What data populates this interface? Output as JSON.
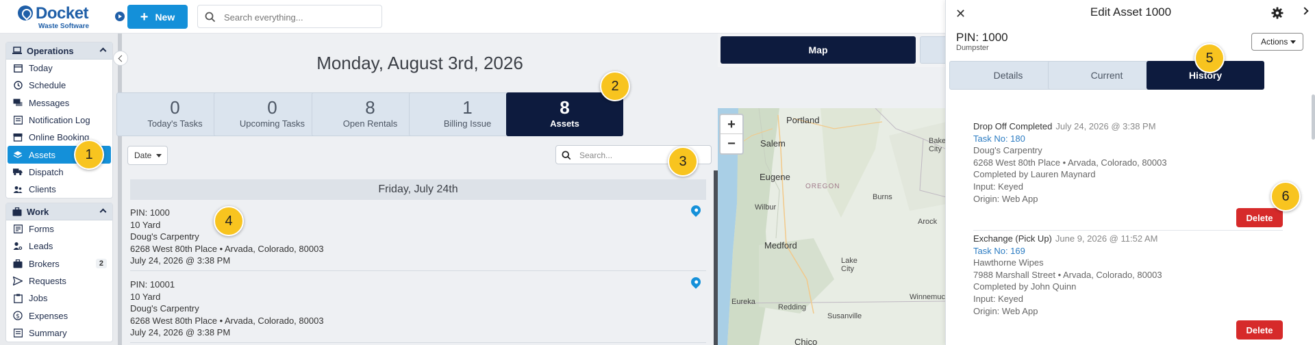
{
  "header": {
    "logo_name": "Docket",
    "logo_sub": "Waste Software",
    "new_label": "New",
    "search_placeholder": "Search everything..."
  },
  "sidebar": {
    "operations": {
      "title": "Operations",
      "items": [
        {
          "label": "Today",
          "icon": "calendar-icon"
        },
        {
          "label": "Schedule",
          "icon": "clock-icon"
        },
        {
          "label": "Messages",
          "icon": "chat-icon"
        },
        {
          "label": "Notification Log",
          "icon": "list-icon"
        },
        {
          "label": "Online Booking",
          "icon": "storefront-icon"
        },
        {
          "label": "Assets",
          "icon": "layers-icon",
          "active": true
        },
        {
          "label": "Dispatch",
          "icon": "truck-icon"
        },
        {
          "label": "Clients",
          "icon": "users-icon"
        }
      ]
    },
    "work": {
      "title": "Work",
      "items": [
        {
          "label": "Forms",
          "icon": "form-icon"
        },
        {
          "label": "Leads",
          "icon": "user-search-icon"
        },
        {
          "label": "Brokers",
          "icon": "briefcase-icon",
          "badge": "2"
        },
        {
          "label": "Requests",
          "icon": "send-icon"
        },
        {
          "label": "Jobs",
          "icon": "clipboard-icon"
        },
        {
          "label": "Expenses",
          "icon": "dollar-icon"
        },
        {
          "label": "Summary",
          "icon": "list-icon"
        }
      ]
    }
  },
  "main": {
    "date_title": "Monday, August 3rd, 2026",
    "stats": [
      {
        "num": "0",
        "label": "Today's Tasks"
      },
      {
        "num": "0",
        "label": "Upcoming Tasks"
      },
      {
        "num": "8",
        "label": "Open Rentals"
      },
      {
        "num": "1",
        "label": "Billing Issue"
      },
      {
        "num": "8",
        "label": "Assets",
        "active": true
      }
    ],
    "date_filter": "Date",
    "search_placeholder": "Search...",
    "day_header": "Friday, July 24th",
    "items": [
      {
        "pin": "PIN: 1000",
        "size": "10 Yard",
        "client": "Doug's Carpentry",
        "address": "6268 West 80th Place • Arvada, Colorado, 80003",
        "datetime": "July 24, 2026 @ 3:38 PM"
      },
      {
        "pin": "PIN: 10001",
        "size": "10 Yard",
        "client": "Doug's Carpentry",
        "address": "6268 West 80th Place • Arvada, Colorado, 80003",
        "datetime": "July 24, 2026 @ 3:38 PM"
      }
    ]
  },
  "map": {
    "tab_label": "Map",
    "zoom_in": "+",
    "zoom_out": "−",
    "labels": {
      "portland": "Portland",
      "salem": "Salem",
      "eugene": "Eugene",
      "oregon": "OREGON",
      "wilbur": "Wilbur",
      "medford": "Medford",
      "lake_city": "Lake City",
      "burns": "Burns",
      "baker_city": "Baker City",
      "arock": "Arock",
      "eureka": "Eureka",
      "redding": "Redding",
      "susanville": "Susanville",
      "winnemucca": "Winnemucca",
      "chico": "Chico"
    }
  },
  "panel": {
    "title": "Edit Asset 1000",
    "pin_title": "PIN: 1000",
    "pin_sub": "Dumpster",
    "actions_label": "Actions",
    "tabs": [
      {
        "label": "Details"
      },
      {
        "label": "Current"
      },
      {
        "label": "History",
        "active": true
      }
    ],
    "history": [
      {
        "title": "Drop Off Completed",
        "date": "July 24, 2026 @ 3:38 PM",
        "task": "Task No: 180",
        "client": "Doug's Carpentry",
        "address": "6268 West 80th Place • Arvada, Colorado, 80003",
        "by": "Completed by Lauren Maynard",
        "input": "Input: Keyed",
        "origin": "Origin: Web App",
        "delete_label": "Delete"
      },
      {
        "title": "Exchange (Pick Up)",
        "date": "June 9, 2026 @ 11:52 AM",
        "task": "Task No: 169",
        "client": "Hawthorne Wipes",
        "address": "7988 Marshall Street • Arvada, Colorado, 80003",
        "by": "Completed by John Quinn",
        "input": "Input: Keyed",
        "origin": "Origin: Web App",
        "delete_label": "Delete"
      }
    ]
  },
  "callouts": [
    "1",
    "2",
    "3",
    "4",
    "5",
    "6"
  ],
  "colors": {
    "brand": "#1f5fa8",
    "accent": "#1490d9",
    "navy": "#0d1b3e",
    "danger": "#d62a2a",
    "callout": "#f8c41f"
  }
}
